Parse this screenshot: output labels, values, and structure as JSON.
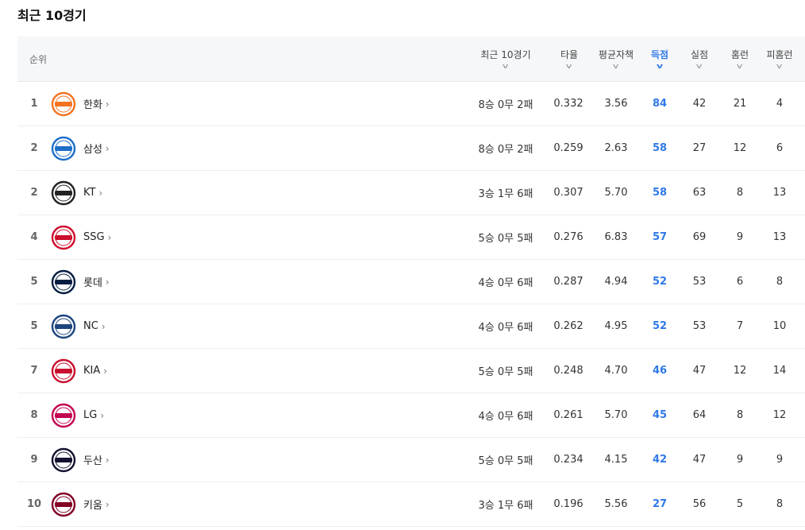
{
  "section": {
    "title": "최근 10경기"
  },
  "headers": {
    "rank": "순위",
    "record": "최근 10경기",
    "avg": "타율",
    "era": "평균자책",
    "runs": "득점",
    "runs_allowed": "실점",
    "hr": "홈런",
    "hr_allowed": "피홈런"
  },
  "colors": {
    "accent": "#2f79e8"
  },
  "teams": [
    {
      "rank": "1",
      "name": "한화",
      "logo": "eagles-logo",
      "logo_color": "#f37321",
      "record": "8승 0무 2패",
      "avg": "0.332",
      "era": "3.56",
      "runs": "84",
      "runs_allowed": "42",
      "hr": "21",
      "hr_allowed": "4"
    },
    {
      "rank": "2",
      "name": "삼성",
      "logo": "lions-logo",
      "logo_color": "#1e6ec9",
      "record": "8승 0무 2패",
      "avg": "0.259",
      "era": "2.63",
      "runs": "58",
      "runs_allowed": "27",
      "hr": "12",
      "hr_allowed": "6"
    },
    {
      "rank": "2",
      "name": "KT",
      "logo": "ktwiz-logo",
      "logo_color": "#222222",
      "record": "3승 1무 6패",
      "avg": "0.307",
      "era": "5.70",
      "runs": "58",
      "runs_allowed": "63",
      "hr": "8",
      "hr_allowed": "13"
    },
    {
      "rank": "4",
      "name": "SSG",
      "logo": "landers-logo",
      "logo_color": "#ce0e2d",
      "record": "5승 0무 5패",
      "avg": "0.276",
      "era": "6.83",
      "runs": "57",
      "runs_allowed": "69",
      "hr": "9",
      "hr_allowed": "13"
    },
    {
      "rank": "5",
      "name": "롯데",
      "logo": "giants-logo",
      "logo_color": "#041e42",
      "record": "4승 0무 6패",
      "avg": "0.287",
      "era": "4.94",
      "runs": "52",
      "runs_allowed": "53",
      "hr": "6",
      "hr_allowed": "8"
    },
    {
      "rank": "5",
      "name": "NC",
      "logo": "dinos-logo",
      "logo_color": "#1d467f",
      "record": "4승 0무 6패",
      "avg": "0.262",
      "era": "4.95",
      "runs": "52",
      "runs_allowed": "53",
      "hr": "7",
      "hr_allowed": "10"
    },
    {
      "rank": "7",
      "name": "KIA",
      "logo": "tigers-logo",
      "logo_color": "#c8102e",
      "record": "5승 0무 5패",
      "avg": "0.248",
      "era": "4.70",
      "runs": "46",
      "runs_allowed": "47",
      "hr": "12",
      "hr_allowed": "14"
    },
    {
      "rank": "8",
      "name": "LG",
      "logo": "twins-logo",
      "logo_color": "#c30452",
      "record": "4승 0무 6패",
      "avg": "0.261",
      "era": "5.70",
      "runs": "45",
      "runs_allowed": "64",
      "hr": "8",
      "hr_allowed": "12"
    },
    {
      "rank": "9",
      "name": "두산",
      "logo": "bears-logo",
      "logo_color": "#131230",
      "record": "5승 0무 5패",
      "avg": "0.234",
      "era": "4.15",
      "runs": "42",
      "runs_allowed": "47",
      "hr": "9",
      "hr_allowed": "9"
    },
    {
      "rank": "10",
      "name": "키움",
      "logo": "heroes-logo",
      "logo_color": "#820024",
      "record": "3승 1무 6패",
      "avg": "0.196",
      "era": "5.56",
      "runs": "27",
      "runs_allowed": "56",
      "hr": "5",
      "hr_allowed": "8"
    }
  ]
}
